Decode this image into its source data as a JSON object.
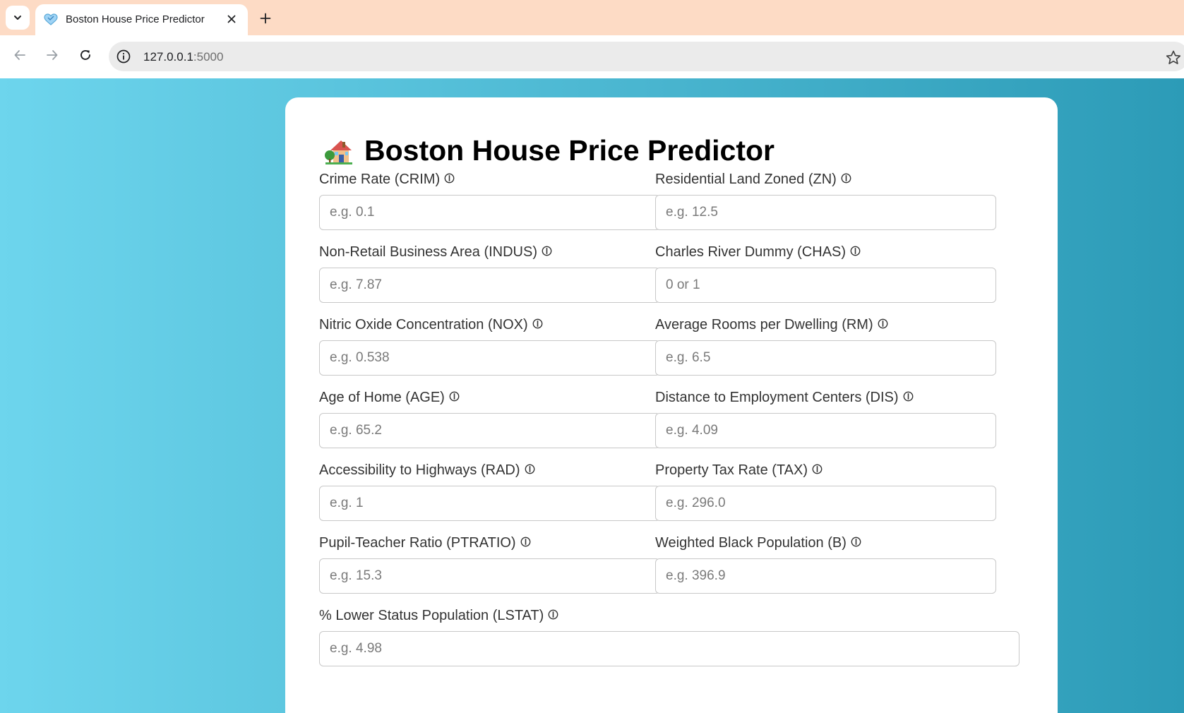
{
  "browser": {
    "tab_title": "Boston House Price Predictor",
    "url_host": "127.0.0.1",
    "url_port": ":5000"
  },
  "page": {
    "heading": "Boston House Price Predictor",
    "heading_icon": "house-with-garden-icon",
    "fields": [
      {
        "label": "Crime Rate (CRIM)",
        "placeholder": "e.g. 0.1"
      },
      {
        "label": "Residential Land Zoned (ZN)",
        "placeholder": "e.g. 12.5"
      },
      {
        "label": "Non-Retail Business Area (INDUS)",
        "placeholder": "e.g. 7.87"
      },
      {
        "label": "Charles River Dummy (CHAS)",
        "placeholder": "0 or 1"
      },
      {
        "label": "Nitric Oxide Concentration (NOX)",
        "placeholder": "e.g. 0.538"
      },
      {
        "label": "Average Rooms per Dwelling (RM)",
        "placeholder": "e.g. 6.5"
      },
      {
        "label": "Age of Home (AGE)",
        "placeholder": "e.g. 65.2"
      },
      {
        "label": "Distance to Employment Centers (DIS)",
        "placeholder": "e.g. 4.09"
      },
      {
        "label": "Accessibility to Highways (RAD)",
        "placeholder": "e.g. 1"
      },
      {
        "label": "Property Tax Rate (TAX)",
        "placeholder": "e.g. 296.0"
      },
      {
        "label": "Pupil-Teacher Ratio (PTRATIO)",
        "placeholder": "e.g. 15.3"
      },
      {
        "label": "Weighted Black Population (B)",
        "placeholder": "e.g. 396.9"
      },
      {
        "label": "% Lower Status Population (LSTAT)",
        "placeholder": "e.g. 4.98"
      }
    ]
  },
  "colors": {
    "tabbar": "#fddbc5",
    "gradient_start": "#6dd5ed",
    "gradient_end": "#2c9bb7"
  }
}
